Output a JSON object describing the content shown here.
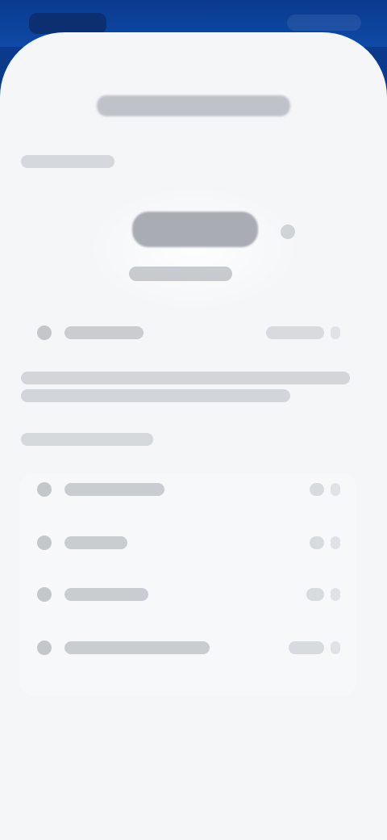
{
  "screen": {
    "title": "",
    "section_1": "",
    "hero_value": "",
    "hero_subtext": "",
    "section_2": ""
  },
  "rows": [
    {
      "label": "",
      "value": ""
    },
    {
      "label": "",
      "value": ""
    },
    {
      "label": "",
      "value": ""
    },
    {
      "label": "",
      "value": ""
    },
    {
      "label": "",
      "value": ""
    }
  ],
  "colors": {
    "header_blue": "#0b3a8c",
    "sheet_background": "#f5f6f8"
  }
}
